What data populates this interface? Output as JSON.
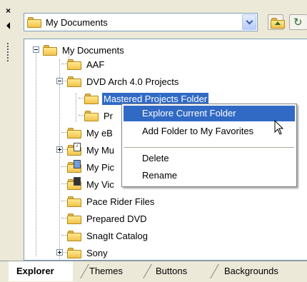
{
  "panel": {
    "combo_value": "My Documents"
  },
  "tree": {
    "items": [
      {
        "label": "My Documents"
      },
      {
        "label": "AAF"
      },
      {
        "label": "DVD Arch 4.0 Projects"
      },
      {
        "label": "Mastered Projects Folder"
      },
      {
        "label": "Pr"
      },
      {
        "label": "My eB"
      },
      {
        "label": "My Mu"
      },
      {
        "label": "My Pic"
      },
      {
        "label": "My Vic"
      },
      {
        "label": "Pace Rider Files"
      },
      {
        "label": "Prepared DVD"
      },
      {
        "label": "SnagIt Catalog"
      },
      {
        "label": "Sony"
      }
    ]
  },
  "context_menu": {
    "items": [
      {
        "label": "Explore Current Folder"
      },
      {
        "label": "Add Folder to My Favorites"
      },
      {
        "label": "Delete"
      },
      {
        "label": "Rename"
      }
    ]
  },
  "tabs": [
    {
      "label": "Explorer"
    },
    {
      "label": "Themes"
    },
    {
      "label": "Buttons"
    },
    {
      "label": "Backgrounds"
    }
  ],
  "colors": {
    "selection": "#316ac5",
    "panel_bg": "#ece9d8",
    "folder": "#f2c34c"
  }
}
